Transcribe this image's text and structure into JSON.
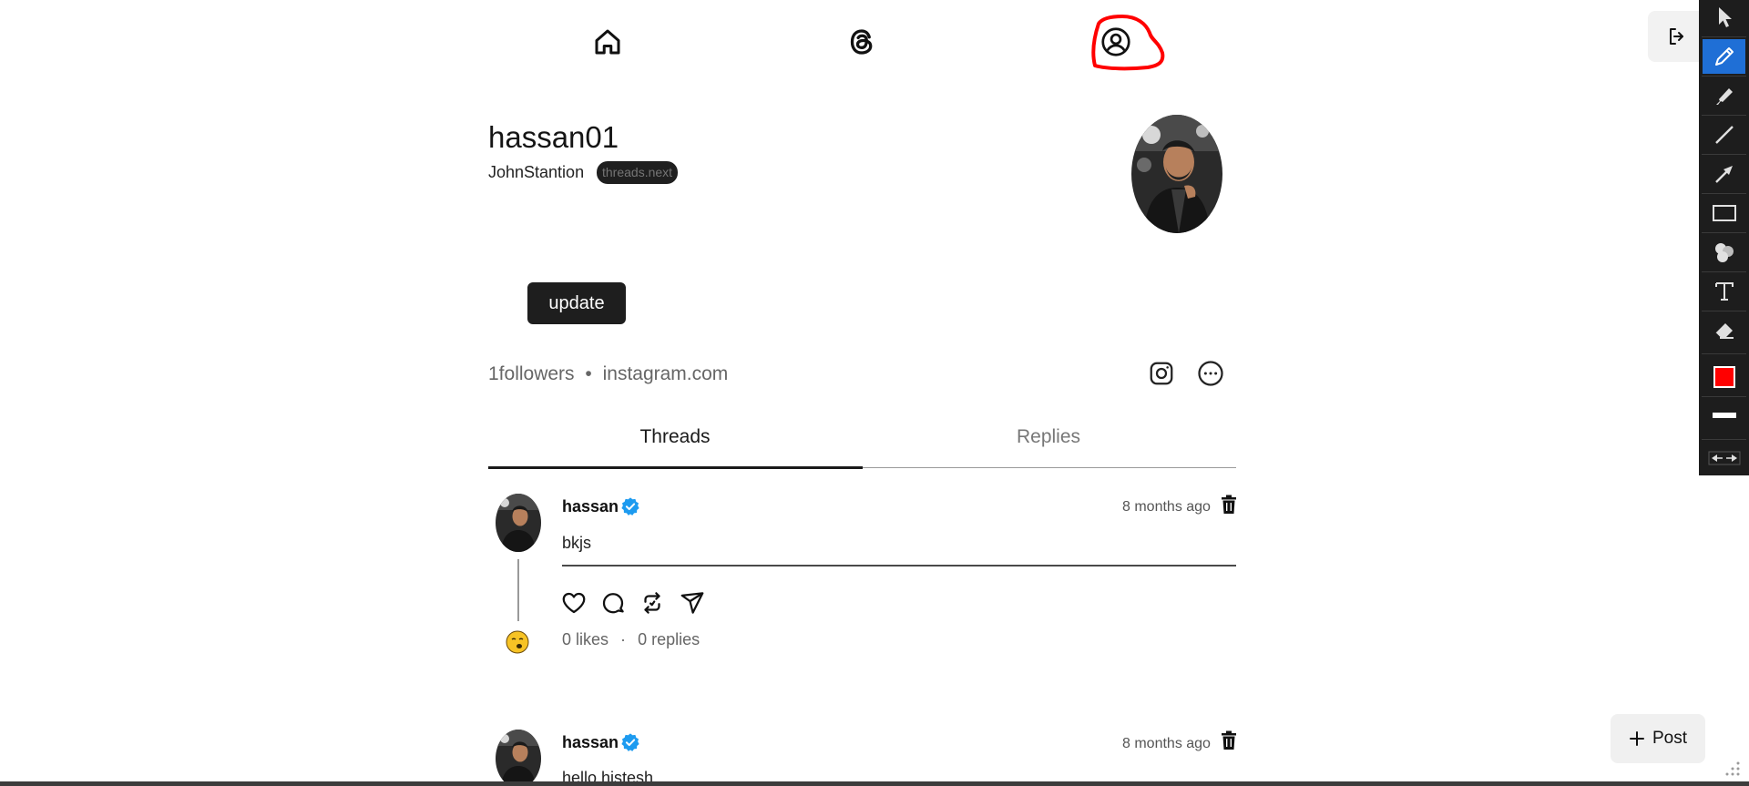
{
  "profile": {
    "username": "hassan01",
    "full_name": "JohnStantion",
    "domain_badge": "threads.next",
    "update_label": "update",
    "followers_text": "1followers",
    "stats_separator": "•",
    "link_text": "instagram.com"
  },
  "tabs": [
    {
      "label": "Threads",
      "active": true
    },
    {
      "label": "Replies",
      "active": false
    }
  ],
  "posts": [
    {
      "user": "hassan",
      "time": "8 months ago",
      "text": "bkjs",
      "likes_text": "0 likes",
      "meta_separator": "·",
      "replies_text": "0 replies"
    },
    {
      "user": "hassan",
      "time": "8 months ago",
      "text": "hello histesh"
    }
  ],
  "post_button": {
    "label": "Post"
  },
  "icons": {
    "nav": [
      "home-icon",
      "threads-logo-icon",
      "profile-icon"
    ],
    "logout": "logout-icon",
    "social": [
      "instagram-icon",
      "more-icon"
    ],
    "actions": [
      "heart-icon",
      "comment-icon",
      "repost-icon",
      "share-icon"
    ],
    "toolbar": [
      "cursor-icon",
      "pen-icon",
      "marker-icon",
      "line-icon",
      "arrow-icon",
      "rectangle-icon",
      "counter-icon",
      "text-icon",
      "eraser-icon",
      "color-swatch",
      "stroke-width-icon",
      "resize-arrows-icon"
    ]
  },
  "colors": {
    "annotation": "#ff0000",
    "verified": "#1d9bf0",
    "toolbar_active": "#1f6fd6",
    "toolbar_bg": "#1d1d1d",
    "button_dark": "#1e1e1e"
  }
}
